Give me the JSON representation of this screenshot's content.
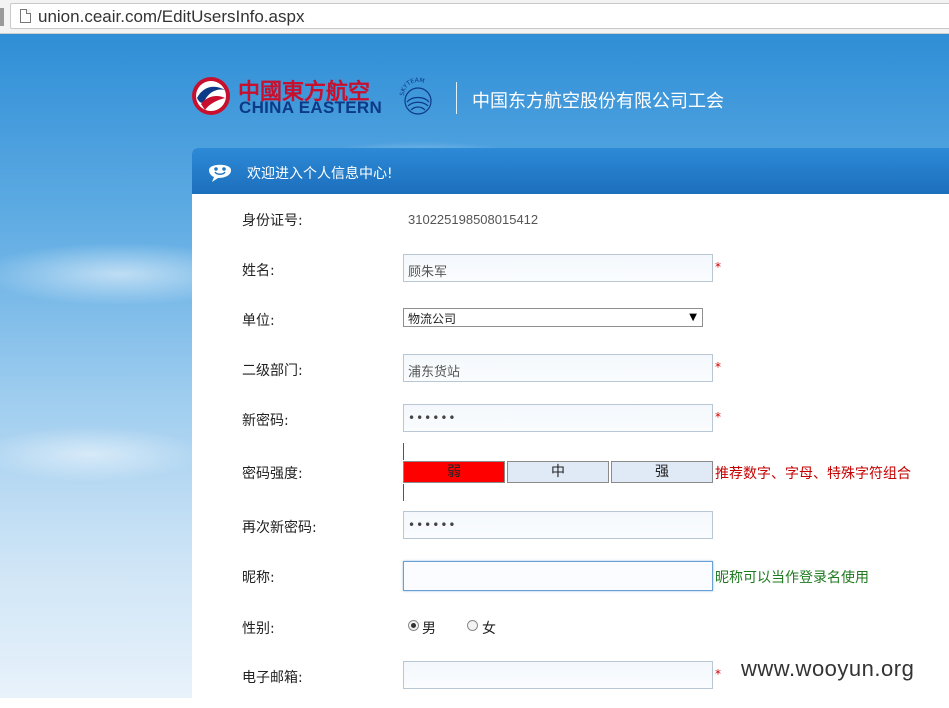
{
  "browser": {
    "url": "union.ceair.com/EditUsersInfo.aspx"
  },
  "header": {
    "brand_cn": "中國東方航空",
    "brand_en": "CHINA EASTERN",
    "skyteam_text": "SKYTEAM",
    "union_title": "中国东方航空股份有限公司工会"
  },
  "panel": {
    "title": "欢迎进入个人信息中心!"
  },
  "form": {
    "id_label": "身份证号:",
    "id_value": "310225198508015412",
    "name_label": "姓名:",
    "name_value": "顾朱军",
    "unit_label": "单位:",
    "unit_value": "物流公司",
    "dept_label": "二级部门:",
    "dept_value": "浦东货站",
    "newpw_label": "新密码:",
    "newpw_value": "••••••",
    "strength_label": "密码强度:",
    "strength_levels": [
      "弱",
      "中",
      "强"
    ],
    "strength_active_color": "#ff0000",
    "strength_hint": "推荐数字、字母、特殊字符组合",
    "repw_label": "再次新密码:",
    "repw_value": "••••••",
    "nick_label": "昵称:",
    "nick_value": "",
    "nick_hint": "昵称可以当作登录名使用",
    "gender_label": "性别:",
    "gender_male": "男",
    "gender_female": "女",
    "email_label": "电子邮箱:",
    "email_value": "",
    "required_mark": "*"
  },
  "watermark": "www.wooyun.org",
  "colors": {
    "panel_header": "#1f76c4",
    "required": "#d00000",
    "hint_red": "#c40000",
    "hint_green": "#1f7a1f",
    "brand_red": "#c8102e",
    "brand_blue": "#0b3a86"
  },
  "icons": {
    "page": "page-icon",
    "logo": "china-eastern-logo-icon",
    "skyteam": "skyteam-logo-icon",
    "smile": "smile-icon",
    "dropdown": "chevron-down-icon"
  }
}
